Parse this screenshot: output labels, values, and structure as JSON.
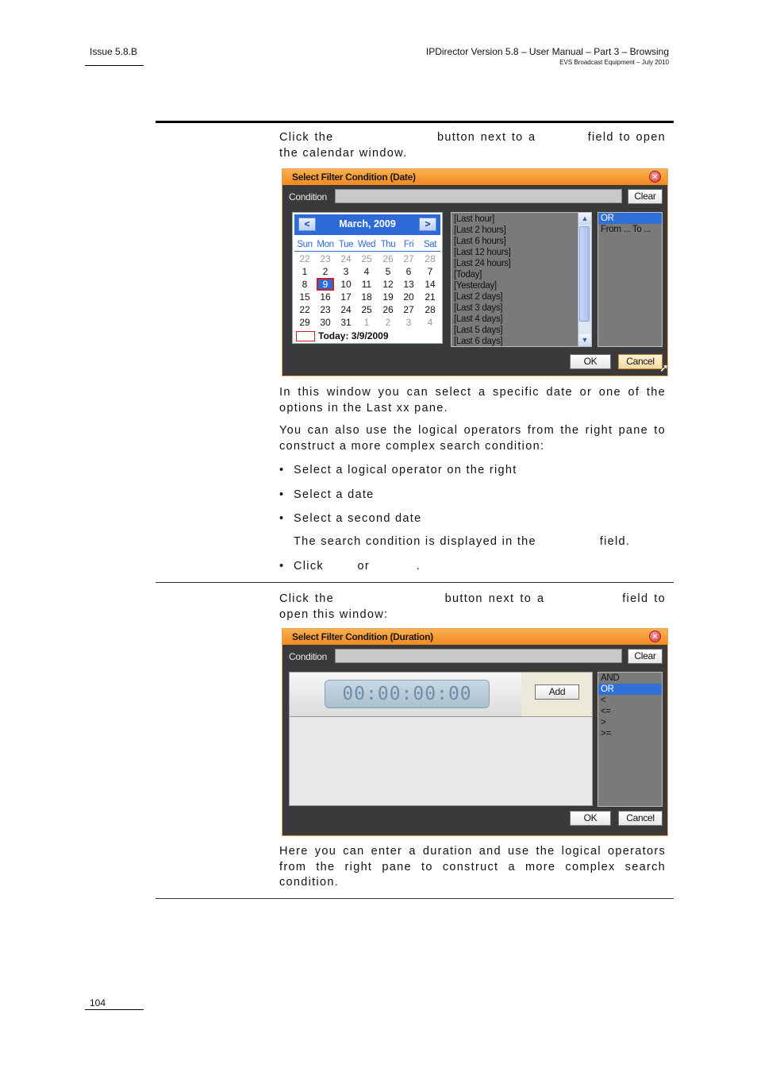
{
  "header": {
    "issue": "Issue 5.8.B",
    "title": "IPDirector Version 5.8 – User Manual – Part 3 – Browsing",
    "subtitle": "EVS Broadcast Equipment – July 2010"
  },
  "footer": {
    "page_number": "104"
  },
  "row1": {
    "intro_line1": "Click the                    button next to a          field to open",
    "intro_line2": "the calendar window.",
    "para1_line1": "In this window you can select a specific date or one of the",
    "para1_line2": "options in the Last xx pane.",
    "para2_line1": "You can also use the logical operators from the right pane to",
    "para2_line2": "construct a more complex search condition:",
    "bullets": [
      "Select a logical operator on the right",
      "Select a date",
      "Select a second date"
    ],
    "note": "The search condition is displayed in the               field.",
    "click_bullet": "Click        or           ."
  },
  "date_dialog": {
    "title": "Select Filter Condition (Date)",
    "condition_label": "Condition",
    "condition_value": "",
    "clear_label": "Clear",
    "ok_label": "OK",
    "cancel_label": "Cancel",
    "calendar": {
      "month_label": "March, 2009",
      "prev_label": "<",
      "next_label": ">",
      "weekdays": [
        "Sun",
        "Mon",
        "Tue",
        "Wed",
        "Thu",
        "Fri",
        "Sat"
      ],
      "weeks": [
        [
          "22",
          "23",
          "24",
          "25",
          "26",
          "27",
          "28"
        ],
        [
          "1",
          "2",
          "3",
          "4",
          "5",
          "6",
          "7"
        ],
        [
          "8",
          "9",
          "10",
          "11",
          "12",
          "13",
          "14"
        ],
        [
          "15",
          "16",
          "17",
          "18",
          "19",
          "20",
          "21"
        ],
        [
          "22",
          "23",
          "24",
          "25",
          "26",
          "27",
          "28"
        ],
        [
          "29",
          "30",
          "31",
          "1",
          "2",
          "3",
          "4"
        ]
      ],
      "selected_day": "9",
      "today_label": "Today: 3/9/2009"
    },
    "last_options": [
      "[Last hour]",
      "[Last 2 hours]",
      "[Last 6 hours]",
      "[Last 12 hours]",
      "[Last 24 hours]",
      "[Today]",
      "[Yesterday]",
      "[Last 2 days]",
      "[Last 3 days]",
      "[Last 4 days]",
      "[Last 5 days]",
      "[Last 6 days]"
    ],
    "operators": [
      "OR",
      "From ... To ..."
    ],
    "selected_operator": "OR"
  },
  "row2": {
    "intro_line1": "Click the                    button next to a              field to",
    "intro_line2": "open this window:",
    "para_line1": "Here you can enter a duration and use the logical operators",
    "para_line2": "from the right pane to construct a more complex search",
    "para_line3": "condition."
  },
  "duration_dialog": {
    "title": "Select Filter Condition (Duration)",
    "condition_label": "Condition",
    "condition_value": "",
    "clear_label": "Clear",
    "timecode": "00:00:00:00",
    "add_label": "Add",
    "ok_label": "OK",
    "cancel_label": "Cancel",
    "operators": [
      "AND",
      "OR",
      "<",
      "<=",
      ">",
      ">="
    ],
    "selected_operator": "OR"
  },
  "colors": {
    "title_bar": "#f39a30",
    "dialog_bg": "#3a3a3a",
    "selection": "#2f6fd6",
    "calendar_header": "#2d6ad8"
  }
}
